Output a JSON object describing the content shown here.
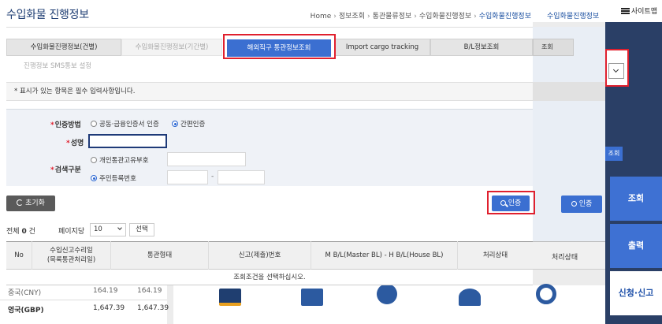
{
  "background": {
    "site_map": "사이트맵",
    "breadcrumb_last": "수입화물진행정보",
    "tab_partial": "조회",
    "small_button": "조회",
    "auth_button": "인증",
    "header_label": "처리상태",
    "side_buttons": [
      "조회",
      "출력",
      "신청·신고"
    ],
    "rates": [
      {
        "label": "중국(CNY)",
        "v1": "164.19",
        "v2": "164.19"
      },
      {
        "label": "영국(GBP)",
        "v1": "1,647.39",
        "v2": "1,647.39"
      }
    ]
  },
  "page": {
    "title": "수입화물 진행정보",
    "breadcrumb": [
      "Home",
      "정보조회",
      "통관물류정보",
      "수입화물진행정보",
      "수입화물진행정보"
    ]
  },
  "tabs": [
    {
      "label": "수입화물진행정보(건별)",
      "state": "normal"
    },
    {
      "label": "수입화물진행정보(기간별)",
      "state": "muted"
    },
    {
      "label": "해외직구 통관정보조회",
      "state": "active"
    },
    {
      "label": "Import cargo tracking",
      "state": "normal"
    },
    {
      "label": "B/L정보조회",
      "state": "normal"
    }
  ],
  "tab_row2": "진행정보 SMS통보 설정",
  "notice": "* 표시가 있는 항목은 필수 입력사항입니다.",
  "form": {
    "auth_method_label": "인증방법",
    "auth_options": [
      "공동·금융인증서 인증",
      "간편인증"
    ],
    "name_label": "성명",
    "name_value": "",
    "search_type_label": "검색구분",
    "search_options": [
      "개인통관고유부호",
      "주민등록번호"
    ],
    "dash": "-"
  },
  "buttons": {
    "reset": "초기화",
    "auth": "인증",
    "select": "선택"
  },
  "list": {
    "total_label": "전체",
    "total_count": "0",
    "total_unit": "건",
    "per_page_label": "페이지당",
    "per_page_value": "10",
    "columns": [
      "No",
      "수입신고수리일\n(목록통관처리일)",
      "통관형태",
      "신고(제출)번호",
      "M B/L(Master BL) - H B/L(House BL)",
      "처리상태"
    ],
    "empty_message": "조회조건을 선택하십시오."
  },
  "colors": {
    "accent": "#3b6fd1",
    "highlight": "#e0202e",
    "title": "#1e3d73"
  }
}
